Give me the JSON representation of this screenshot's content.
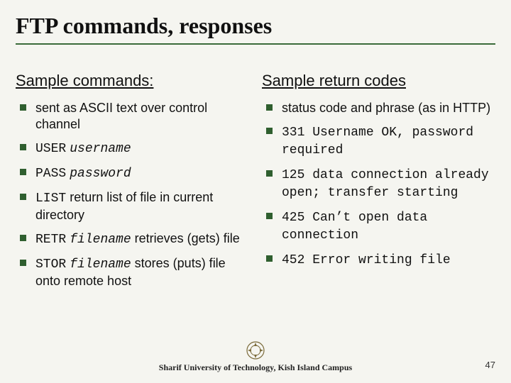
{
  "title": "FTP commands, responses",
  "left": {
    "heading": "Sample commands:",
    "items": [
      {
        "plain": "sent as ASCII text over control channel"
      },
      {
        "cmd": "USER",
        "arg": "username"
      },
      {
        "cmd": "PASS",
        "arg": "password"
      },
      {
        "cmd": "LIST",
        "tail": " return list of file in current directory"
      },
      {
        "cmd": "RETR",
        "arg": "filename",
        "tail": " retrieves (gets) file"
      },
      {
        "cmd": "STOR",
        "arg": "filename",
        "tail": " stores (puts) file onto remote host"
      }
    ]
  },
  "right": {
    "heading": "Sample return codes",
    "items": [
      {
        "plain": "status code and phrase (as in HTTP)"
      },
      {
        "mono": "331 Username OK, password required"
      },
      {
        "mono": "125 data connection already open; transfer starting"
      },
      {
        "mono": "425 Can’t open data connection"
      },
      {
        "mono": "452 Error writing file"
      }
    ]
  },
  "footer": "Sharif University of Technology, Kish Island Campus",
  "page": "47"
}
